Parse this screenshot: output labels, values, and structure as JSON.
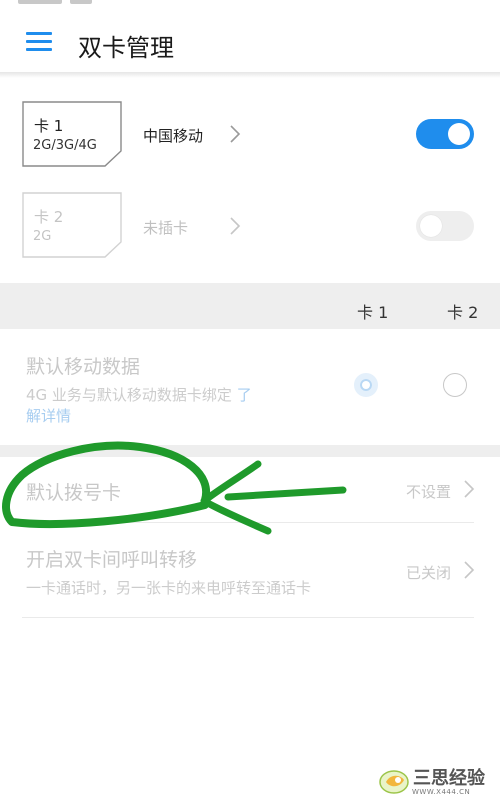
{
  "header": {
    "title": "双卡管理"
  },
  "sims": [
    {
      "name": "卡 1",
      "network": "2G/3G/4G",
      "carrier": "中国移动",
      "enabled": true
    },
    {
      "name": "卡 2",
      "network": "2G",
      "carrier": "未插卡",
      "enabled": false
    }
  ],
  "columns": {
    "card1": "卡 1",
    "card2": "卡 2"
  },
  "default_data": {
    "title": "默认移动数据",
    "subtitle": "4G 业务与默认移动数据卡绑定",
    "link_part1": "了",
    "link_part2": "解详情",
    "selected": "card1"
  },
  "default_dial": {
    "title": "默认拨号卡",
    "value": "不设置"
  },
  "call_forward": {
    "title": "开启双卡间呼叫转移",
    "subtitle": "一卡通话时，另一张卡的来电呼转至通话卡",
    "value": "已关闭"
  },
  "watermark": {
    "text": "三思经验",
    "url": "WWW.X444.CN"
  },
  "colors": {
    "accent": "#1f8ded",
    "annotation": "#1f9a2b",
    "disabled_text": "#c8c8c8"
  }
}
